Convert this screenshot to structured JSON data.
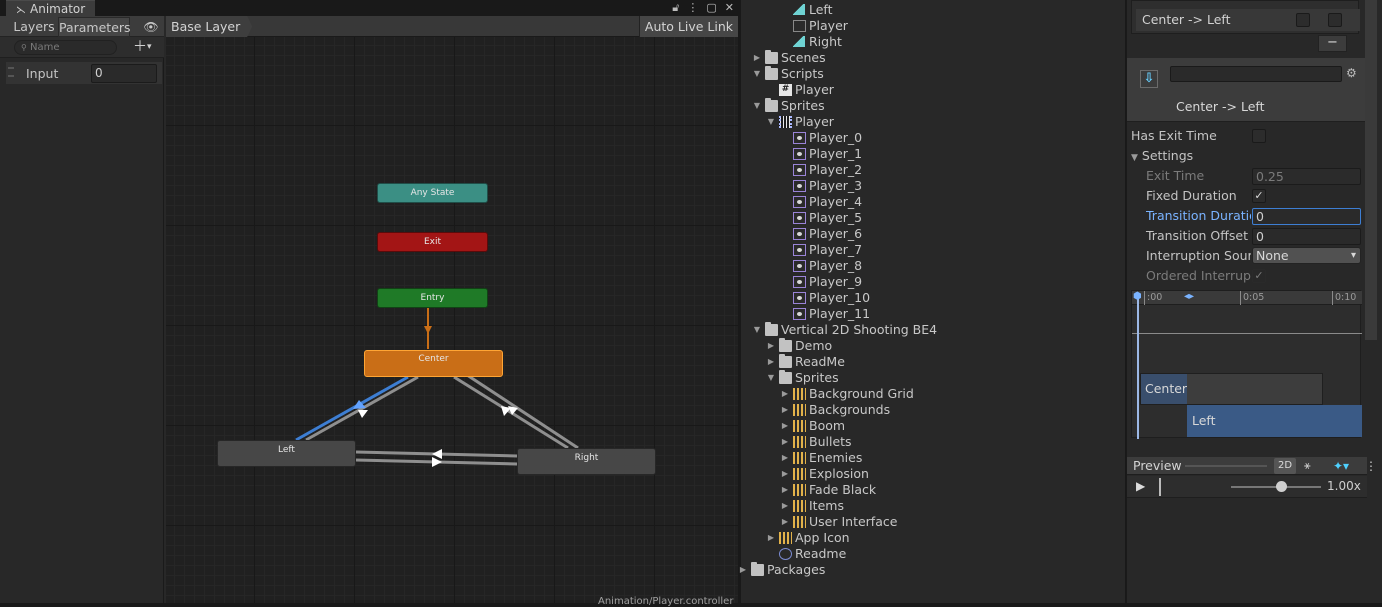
{
  "animator": {
    "tab_title": "Animator",
    "left_tabs": [
      "Layers",
      "Parameters"
    ],
    "search_placeholder": "Name",
    "parameters": [
      {
        "name": "Input",
        "value": "0"
      }
    ],
    "breadcrumb": "Base Layer",
    "auto_live_link": "Auto Live Link",
    "states": {
      "any_state": "Any State",
      "exit": "Exit",
      "entry": "Entry",
      "center": "Center",
      "left": "Left",
      "right": "Right"
    },
    "status_path": "Animation/Player.controller",
    "colors": {
      "any_state": "#3b8f84",
      "exit": "#a31515",
      "entry": "#1f7a27",
      "default_state": "#c96e17",
      "selected_transition": "#3d7ed3"
    }
  },
  "project": {
    "items": [
      {
        "label": "Left",
        "icon": "animation-clip-icon",
        "arrow": ""
      },
      {
        "label": "Player",
        "icon": "animator-controller-icon",
        "arrow": ""
      },
      {
        "label": "Right",
        "icon": "animation-clip-icon",
        "arrow": ""
      },
      {
        "label": "Scenes",
        "icon": "folder-icon",
        "arrow": "▶"
      },
      {
        "label": "Scripts",
        "icon": "folder-open-icon",
        "arrow": "▼"
      },
      {
        "label": "Player",
        "icon": "script-icon",
        "arrow": ""
      },
      {
        "label": "Sprites",
        "icon": "folder-open-icon",
        "arrow": "▼"
      },
      {
        "label": "Player",
        "icon": "sprite-sheet-icon",
        "arrow": "▼"
      },
      {
        "label": "Player_0",
        "icon": "sprite-icon",
        "arrow": ""
      },
      {
        "label": "Player_1",
        "icon": "sprite-icon",
        "arrow": ""
      },
      {
        "label": "Player_2",
        "icon": "sprite-icon",
        "arrow": ""
      },
      {
        "label": "Player_3",
        "icon": "sprite-icon",
        "arrow": ""
      },
      {
        "label": "Player_4",
        "icon": "sprite-icon",
        "arrow": ""
      },
      {
        "label": "Player_5",
        "icon": "sprite-icon",
        "arrow": ""
      },
      {
        "label": "Player_6",
        "icon": "sprite-icon",
        "arrow": ""
      },
      {
        "label": "Player_7",
        "icon": "sprite-icon",
        "arrow": ""
      },
      {
        "label": "Player_8",
        "icon": "sprite-icon",
        "arrow": ""
      },
      {
        "label": "Player_9",
        "icon": "sprite-icon",
        "arrow": ""
      },
      {
        "label": "Player_10",
        "icon": "sprite-icon",
        "arrow": ""
      },
      {
        "label": "Player_11",
        "icon": "sprite-icon",
        "arrow": ""
      },
      {
        "label": "Vertical 2D Shooting BE4",
        "icon": "folder-open-icon",
        "arrow": "▼"
      },
      {
        "label": "Demo",
        "icon": "folder-icon",
        "arrow": "▶"
      },
      {
        "label": "ReadMe",
        "icon": "folder-icon",
        "arrow": "▶"
      },
      {
        "label": "Sprites",
        "icon": "folder-open-icon",
        "arrow": "▼"
      },
      {
        "label": "Background Grid",
        "icon": "texture-icon",
        "arrow": "▶"
      },
      {
        "label": "Backgrounds",
        "icon": "texture-icon",
        "arrow": "▶"
      },
      {
        "label": "Boom",
        "icon": "texture-icon",
        "arrow": "▶"
      },
      {
        "label": "Bullets",
        "icon": "texture-icon",
        "arrow": "▶"
      },
      {
        "label": "Enemies",
        "icon": "texture-icon",
        "arrow": "▶"
      },
      {
        "label": "Explosion",
        "icon": "texture-icon",
        "arrow": "▶"
      },
      {
        "label": "Fade Black",
        "icon": "texture-icon",
        "arrow": "▶"
      },
      {
        "label": "Items",
        "icon": "texture-icon",
        "arrow": "▶"
      },
      {
        "label": "User Interface",
        "icon": "texture-icon",
        "arrow": "▶"
      },
      {
        "label": "App Icon",
        "icon": "texture-icon",
        "arrow": "▶"
      },
      {
        "label": "Readme",
        "icon": "readme-asset-icon",
        "arrow": ""
      },
      {
        "label": "Packages",
        "icon": "folder-icon",
        "arrow": "▶"
      }
    ]
  },
  "inspector": {
    "transition_list_item": "Center -> Left",
    "minus_label": "−",
    "header_title": "Center -> Left",
    "has_exit_time_label": "Has Exit Time",
    "settings_label": "Settings",
    "exit_time_label": "Exit Time",
    "exit_time_value": "0.25",
    "fixed_duration_label": "Fixed Duration",
    "transition_duration_label": "Transition Duration",
    "transition_duration_value": "0",
    "transition_offset_label": "Transition Offset",
    "transition_offset_value": "0",
    "interruption_source_label": "Interruption Source",
    "interruption_source_value": "None",
    "ordered_interruption_label": "Ordered Interruption",
    "timeline": {
      "ticks": [
        ":00",
        "0:05",
        "0:10"
      ],
      "source_state": "Center",
      "target_state": "Left"
    },
    "preview": {
      "title": "Preview",
      "mode_2d": "2D",
      "speed": "1.00x"
    }
  }
}
